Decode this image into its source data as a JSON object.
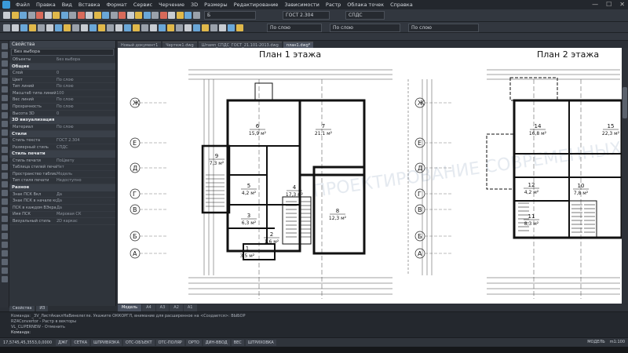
{
  "menu": [
    "Файл",
    "Правка",
    "Вид",
    "Вставка",
    "Формат",
    "Сервис",
    "Черчение",
    "3D",
    "Размеры",
    "Редактирование",
    "Зависимости",
    "Растр",
    "Облака точек",
    "Справка"
  ],
  "toolbar": {
    "layer_combo": "Б",
    "style_combo": "ГОСТ 2.304",
    "dim_combo": "СПДС",
    "linetype_combo": "По слою",
    "lineweight_combo": "По слою",
    "color_combo": "По слою"
  },
  "doc_tabs": [
    "Новый документ1",
    "Чертеж1.dwg",
    "Штамп_СПДС_ГОСТ_21.101-2013.dwg",
    "план1.dwg*"
  ],
  "props": {
    "title": "Свойства",
    "filter": "Без выбора",
    "rows_top": [
      {
        "k": "Объекты",
        "v": "Без выбора"
      }
    ],
    "section_general": "Общие",
    "rows_general": [
      {
        "k": "Слой",
        "v": "0"
      },
      {
        "k": "Цвет",
        "v": "По слою"
      },
      {
        "k": "Тип линий",
        "v": "По слою"
      },
      {
        "k": "Масштаб типа линий",
        "v": "100"
      },
      {
        "k": "Вес линий",
        "v": "По слою"
      },
      {
        "k": "Прозрачность",
        "v": "По слою"
      },
      {
        "k": "Высота 3D",
        "v": "0"
      }
    ],
    "section_3d": "3D визуализация",
    "rows_3d": [
      {
        "k": "Материал",
        "v": "По слою"
      }
    ],
    "section_styles": "Стили",
    "rows_styles": [
      {
        "k": "Стиль текста",
        "v": "ГОСТ 2.304"
      },
      {
        "k": "Размерный стиль",
        "v": "СПДС"
      }
    ],
    "section_print": "Стиль печати",
    "rows_print": [
      {
        "k": "Стиль печати",
        "v": "ПоЦвету"
      },
      {
        "k": "Таблица стилей печати",
        "v": "Нет"
      },
      {
        "k": "Пространство таблицы ст.",
        "v": "Модель"
      },
      {
        "k": "Тип стиля печати",
        "v": "Недоступно"
      }
    ],
    "section_misc": "Разное",
    "rows_misc": [
      {
        "k": "Знак ПСК Вкл",
        "v": "Да"
      },
      {
        "k": "Знак ПСК в начале коорд.",
        "v": "Да"
      },
      {
        "k": "ПСК в каждом ВЭкране",
        "v": "Да"
      },
      {
        "k": "Имя ПСК",
        "v": "Мировая СК"
      },
      {
        "k": "Визуальный стиль",
        "v": "2D каркас"
      }
    ],
    "bottom_tabs": [
      "Свойства",
      "ИЗ"
    ]
  },
  "plans": {
    "plan1_title": "План 1 этажа",
    "plan2_title": "План 2 этажа",
    "axes_letters": [
      "Ж",
      "Е",
      "Д",
      "Г",
      "В",
      "Б",
      "А"
    ],
    "rooms1": [
      {
        "n": "6",
        "a": "15,9 м²"
      },
      {
        "n": "7",
        "a": "21,1 м²"
      },
      {
        "n": "9",
        "a": "7,3 м²"
      },
      {
        "n": "5",
        "a": "4,2 м²"
      },
      {
        "n": "4",
        "a": "17,3 м²"
      },
      {
        "n": "8",
        "a": "12,3 м²"
      },
      {
        "n": "3",
        "a": "6,3 м²"
      },
      {
        "n": "2",
        "a": "1,6 м²"
      },
      {
        "n": "1",
        "a": "3,5 м²"
      }
    ],
    "rooms2": [
      {
        "n": "14",
        "a": "16,8 м²"
      },
      {
        "n": "15",
        "a": "22,3 м²"
      },
      {
        "n": "12",
        "a": "4,2 м²"
      },
      {
        "n": "10",
        "a": "7,8 м²"
      },
      {
        "n": "11",
        "a": "8,3 м²"
      }
    ],
    "watermark": "ПРОЕКТИРОВАНИЕ СОВРЕМЕННЫХ ЗДАНИЙ"
  },
  "model_tabs": [
    "Модель",
    "А4",
    "А3",
    "А2",
    "А1"
  ],
  "console": [
    "Команда: _3V_ЛистАкаклНаВинелегле. Укажите ОККОРГЛ, внимание для расширенное на <Создается>: ВЫБОР",
    "RZ4Convertor - Растр в векторы",
    "VL_CLIPERNEW - Отменить"
  ],
  "console_prompt": "Команда:",
  "status": {
    "coords": "17,5745,45,3553,0,0000",
    "snaps": [
      "ДЖГ",
      "СЕТКА",
      "ШПРИВЯЗКА",
      "ОТС-ОБЪЕКТ",
      "ОТС-ПОЛЯР",
      "ОРТО",
      "ДИН-ВВОД",
      "ВЕС",
      "ШТРИХОВКА"
    ],
    "model": "МОДЕЛЬ",
    "scale": "m1:100"
  },
  "colors": {
    "canvas": "#ffffff",
    "wall": "#111111",
    "dim": "#333333",
    "watermark": "#e3e8ee"
  }
}
